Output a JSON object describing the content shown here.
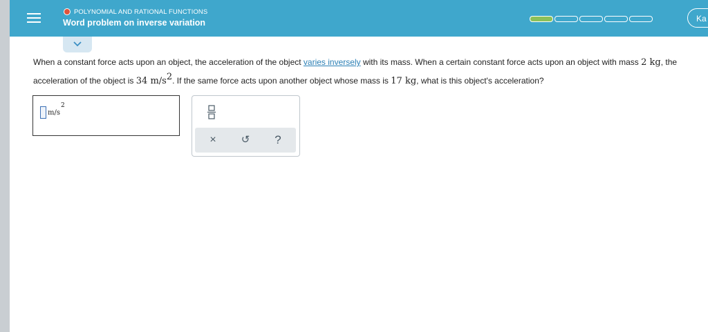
{
  "header": {
    "topic": "POLYNOMIAL AND RATIONAL FUNCTIONS",
    "lesson_title": "Word problem on inverse variation",
    "progress": {
      "completed": 1,
      "total": 5
    },
    "account_label": "Ka"
  },
  "question": {
    "p1": "When a constant force acts upon an object, the acceleration of the object ",
    "link": "varies inversely",
    "p2": " with its mass. When a certain constant force acts upon an object with mass ",
    "mass1": "2 kg",
    "p3": ", the acceleration of the object is ",
    "accel1": "34 m/s",
    "accel1_exp": "2",
    "p4": ". If the same force acts upon another object whose mass is ",
    "mass2": "17 kg",
    "p5": ", what is this object's acceleration?"
  },
  "answer": {
    "unit": "m/s",
    "unit_exp": "2"
  },
  "keypad": {
    "clear_symbol": "×",
    "undo_symbol": "↺",
    "help_symbol": "?"
  },
  "colors": {
    "header_bg": "#3fa7cc",
    "progress_done": "#8bc05a",
    "topic_dot": "#e0533b",
    "link": "#2a7fb5"
  }
}
